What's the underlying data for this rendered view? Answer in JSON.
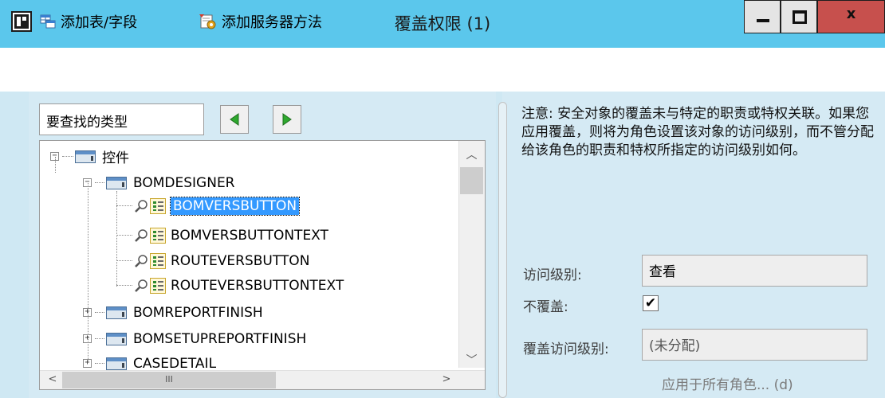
{
  "window": {
    "title": "覆盖权限 (1)",
    "controls": {
      "close_label": "x"
    }
  },
  "toolbar": {
    "add_table_field": "添加表/字段",
    "add_server_method": "添加服务器方法"
  },
  "search": {
    "value": "要查找的类型"
  },
  "tree": {
    "items": [
      {
        "label": "控件",
        "expander": "−",
        "level": 0,
        "icon": "folder-icon"
      },
      {
        "label": "BOMDESIGNER",
        "expander": "−",
        "level": 1,
        "icon": "folder-icon"
      },
      {
        "label": "BOMVERSBUTTON",
        "level": 2,
        "icon": "control-icon",
        "selected": true
      },
      {
        "label": "BOMVERSBUTTONTEXT",
        "level": 2,
        "icon": "control-icon"
      },
      {
        "label": "ROUTEVERSBUTTON",
        "level": 2,
        "icon": "control-icon"
      },
      {
        "label": "ROUTEVERSBUTTONTEXT",
        "level": 2,
        "icon": "control-icon"
      },
      {
        "label": "BOMREPORTFINISH",
        "expander": "+",
        "level": 1,
        "icon": "folder-icon"
      },
      {
        "label": "BOMSETUPREPORTFINISH",
        "expander": "+",
        "level": 1,
        "icon": "folder-icon"
      },
      {
        "label": "CASEDETAIL",
        "expander": "+",
        "level": 1,
        "icon": "folder-icon"
      }
    ],
    "scrollbar_thumb_glyph": "III"
  },
  "details": {
    "note": "注意: 安全对象的覆盖未与特定的职责或特权关联。如果您应用覆盖，则将为角色设置该对象的访问级别，而不管分配给该角色的职责和特权所指定的访问级别如何。",
    "access_level_label": "访问级别:",
    "access_level_value": "查看",
    "no_override_label": "不覆盖:",
    "no_override_checked": true,
    "no_override_mark": "✔",
    "override_access_label": "覆盖访问级别:",
    "override_access_value": "(未分配)",
    "apply_all_label": "应用于所有角色... (d)"
  }
}
